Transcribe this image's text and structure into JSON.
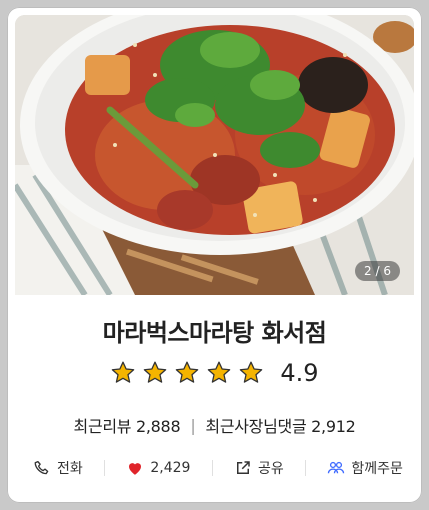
{
  "gallery": {
    "counter": "2 / 6"
  },
  "store": {
    "name": "마라벅스마라탕 화서점",
    "rating": "4.9",
    "stars": 5
  },
  "stats": {
    "reviews": "최근리뷰 2,888",
    "separator": "|",
    "owner_comments": "최근사장님댓글 2,912"
  },
  "actions": {
    "call_label": "전화",
    "like_count": "2,429",
    "share_label": "공유",
    "group_order_label": "함께주문"
  },
  "colors": {
    "star": "#f5b400",
    "heart": "#e0242a",
    "group_icon": "#3f6bff"
  }
}
